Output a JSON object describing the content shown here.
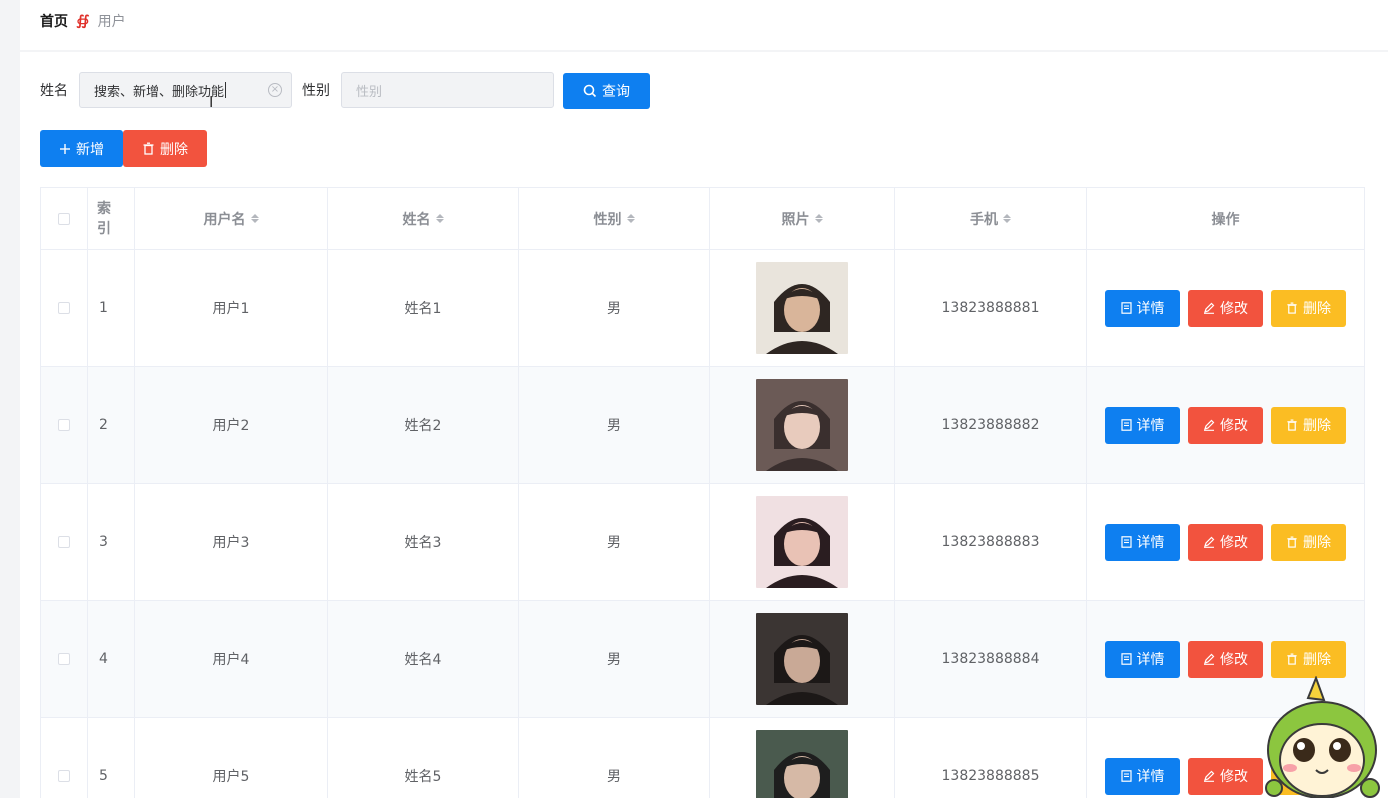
{
  "breadcrumb": {
    "home": "首页",
    "separator": "∯",
    "current": "用户"
  },
  "search": {
    "name_label": "姓名",
    "name_value": "搜索、新增、删除功能",
    "sex_label": "性别",
    "sex_placeholder": "性别",
    "query_label": "查询"
  },
  "toolbar": {
    "add_label": "新增",
    "delete_label": "删除"
  },
  "table": {
    "headers": {
      "index": "索引",
      "username": "用户名",
      "name": "姓名",
      "sex": "性别",
      "photo": "照片",
      "phone": "手机",
      "actions": "操作"
    },
    "actions": {
      "detail": "详情",
      "edit": "修改",
      "delete": "删除"
    },
    "rows": [
      {
        "index": "1",
        "username": "用户1",
        "name": "姓名1",
        "sex": "男",
        "phone": "13823888881"
      },
      {
        "index": "2",
        "username": "用户2",
        "name": "姓名2",
        "sex": "男",
        "phone": "13823888882"
      },
      {
        "index": "3",
        "username": "用户3",
        "name": "姓名3",
        "sex": "男",
        "phone": "13823888883"
      },
      {
        "index": "4",
        "username": "用户4",
        "name": "姓名4",
        "sex": "男",
        "phone": "13823888884"
      },
      {
        "index": "5",
        "username": "用户5",
        "name": "姓名5",
        "sex": "男",
        "phone": "13823888885"
      }
    ]
  },
  "colors": {
    "primary": "#0e7ff0",
    "danger": "#f2533e",
    "warning": "#fbbd23"
  }
}
